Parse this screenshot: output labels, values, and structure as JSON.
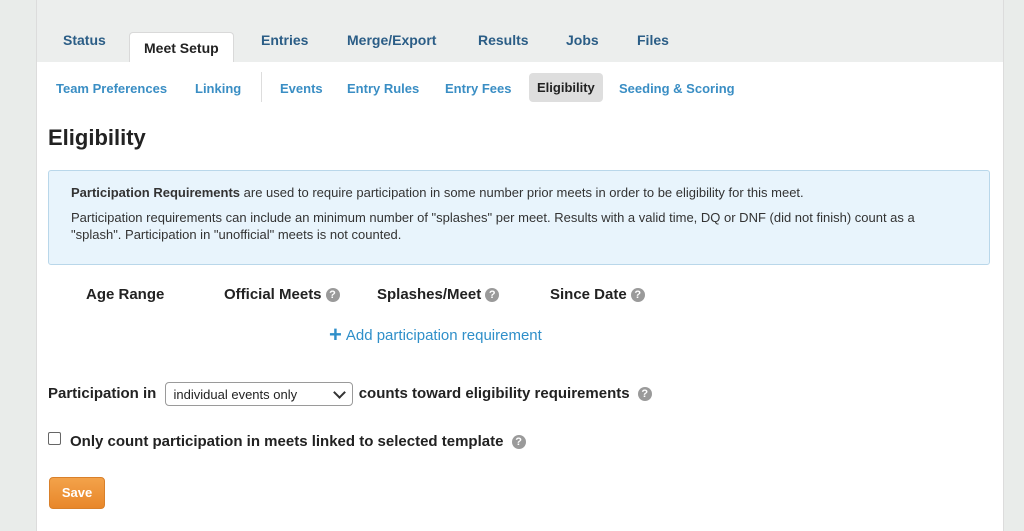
{
  "tabs": [
    {
      "label": "Status"
    },
    {
      "label": "Meet Setup"
    },
    {
      "label": "Entries"
    },
    {
      "label": "Merge/Export"
    },
    {
      "label": "Results"
    },
    {
      "label": "Jobs"
    },
    {
      "label": "Files"
    }
  ],
  "active_tab": "Meet Setup",
  "subnav": [
    {
      "label": "Team Preferences"
    },
    {
      "label": "Linking"
    },
    {
      "label": "Events"
    },
    {
      "label": "Entry Rules"
    },
    {
      "label": "Entry Fees"
    },
    {
      "label": "Eligibility"
    },
    {
      "label": "Seeding & Scoring"
    }
  ],
  "active_subnav": "Eligibility",
  "page_title": "Eligibility",
  "info": {
    "bold_lead": "Participation Requirements",
    "line1_rest": " are used to require participation in some number prior meets in order to be eligibility for this meet.",
    "line2": "Participation requirements can include an minimum number of \"splashes\" per meet. Results with a valid time, DQ or DNF (did not finish) count as a \"splash\". Participation in \"unofficial\" meets is not counted."
  },
  "table_headers": {
    "age_range": "Age Range",
    "official_meets": "Official Meets",
    "splashes_per_meet": "Splashes/Meet",
    "since_date": "Since Date"
  },
  "help_glyph": "?",
  "add_requirement_label": "Add participation requirement",
  "plus_glyph": "+",
  "participation": {
    "prefix": "Participation in",
    "selected": "individual events only",
    "suffix": "counts toward eligibility requirements"
  },
  "linked_template_label": "Only count participation in meets linked to selected template",
  "linked_template_checked": false,
  "save_label": "Save",
  "colors": {
    "link": "#3a8ec4",
    "save_button": "#ee9033",
    "info_bg": "#e8f4fc"
  }
}
